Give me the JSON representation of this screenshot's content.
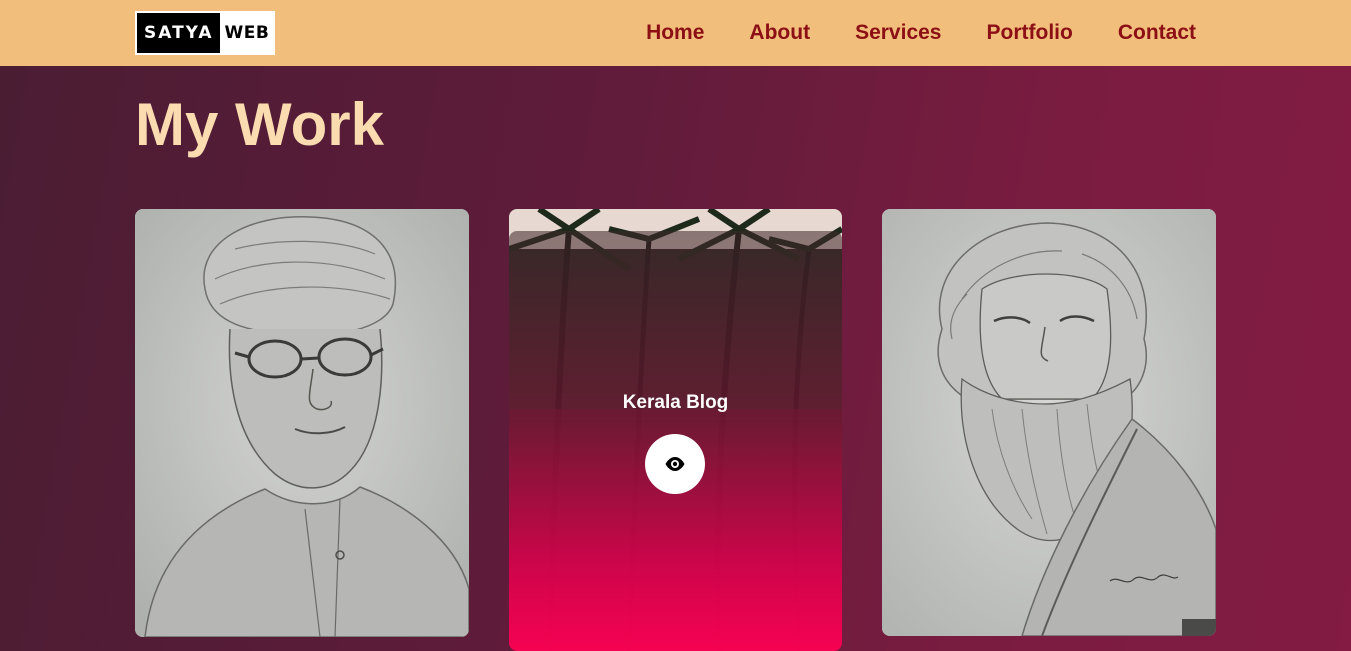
{
  "logo": {
    "left": "SATYA",
    "right": "WEB"
  },
  "nav": {
    "items": [
      {
        "label": "Home"
      },
      {
        "label": "About"
      },
      {
        "label": "Services"
      },
      {
        "label": "Portfolio"
      },
      {
        "label": "Contact"
      }
    ]
  },
  "page": {
    "title": "My Work"
  },
  "portfolio": {
    "items": [
      {
        "title": ""
      },
      {
        "title": "Kerala Blog",
        "action_icon": "eye-icon"
      },
      {
        "title": ""
      }
    ]
  },
  "colors": {
    "navbar_bg": "#f2be7b",
    "nav_link": "#8b0f15",
    "title": "#fbdcb0",
    "accent": "#ff0a52"
  }
}
